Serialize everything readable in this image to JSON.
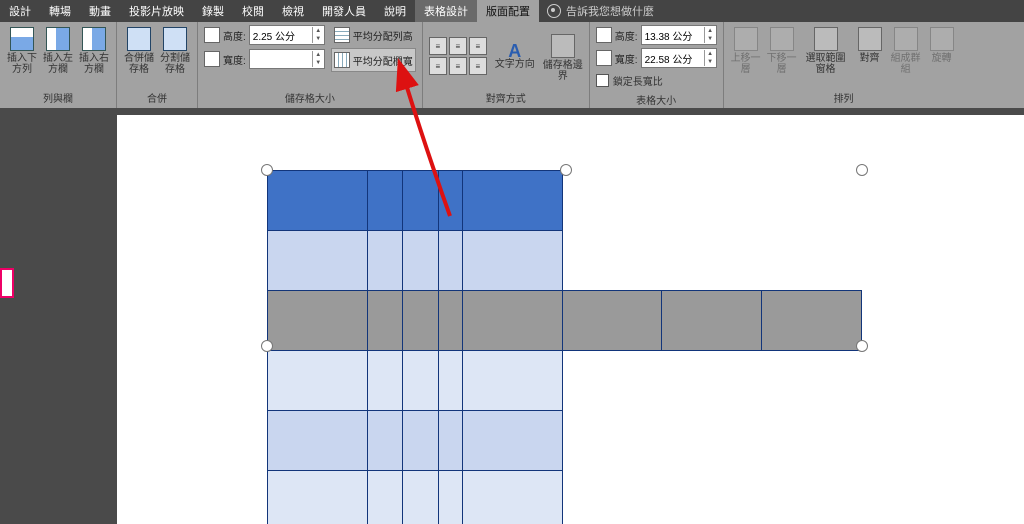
{
  "tabs": {
    "design": "設計",
    "transitions": "轉場",
    "animations": "動畫",
    "slideshow": "投影片放映",
    "record": "錄製",
    "review": "校閱",
    "view": "檢視",
    "developer": "開發人員",
    "help": "說明",
    "table_design": "表格設計",
    "layout": "版面配置",
    "tell_me": "告訴我您想做什麼"
  },
  "rows_cols": {
    "insert_below": "插入下方列",
    "insert_left": "插入左方欄",
    "insert_right": "插入右方欄",
    "group_label": "列與欄"
  },
  "merge": {
    "merge_cells": "合併儲存格",
    "split_cells": "分割儲存格",
    "group_label": "合併"
  },
  "cell_size": {
    "height_label": "高度:",
    "height_value": "2.25 公分",
    "width_label": "寬度:",
    "width_value": "",
    "dist_rows": "平均分配列高",
    "dist_cols": "平均分配欄寬",
    "group_label": "儲存格大小"
  },
  "alignment": {
    "text_dir": "文字方向",
    "cell_margins": "儲存格邊界",
    "group_label": "對齊方式"
  },
  "table_size": {
    "height_label": "高度:",
    "height_value": "13.38 公分",
    "width_label": "寬度:",
    "width_value": "22.58 公分",
    "lock": "鎖定長寬比",
    "group_label": "表格大小"
  },
  "arrange": {
    "bring_fwd": "上移一層",
    "send_back": "下移一層",
    "selection_pane": "選取範圍窗格",
    "align": "對齊",
    "group": "組成群組",
    "rotate": "旋轉",
    "group_label": "排列"
  }
}
